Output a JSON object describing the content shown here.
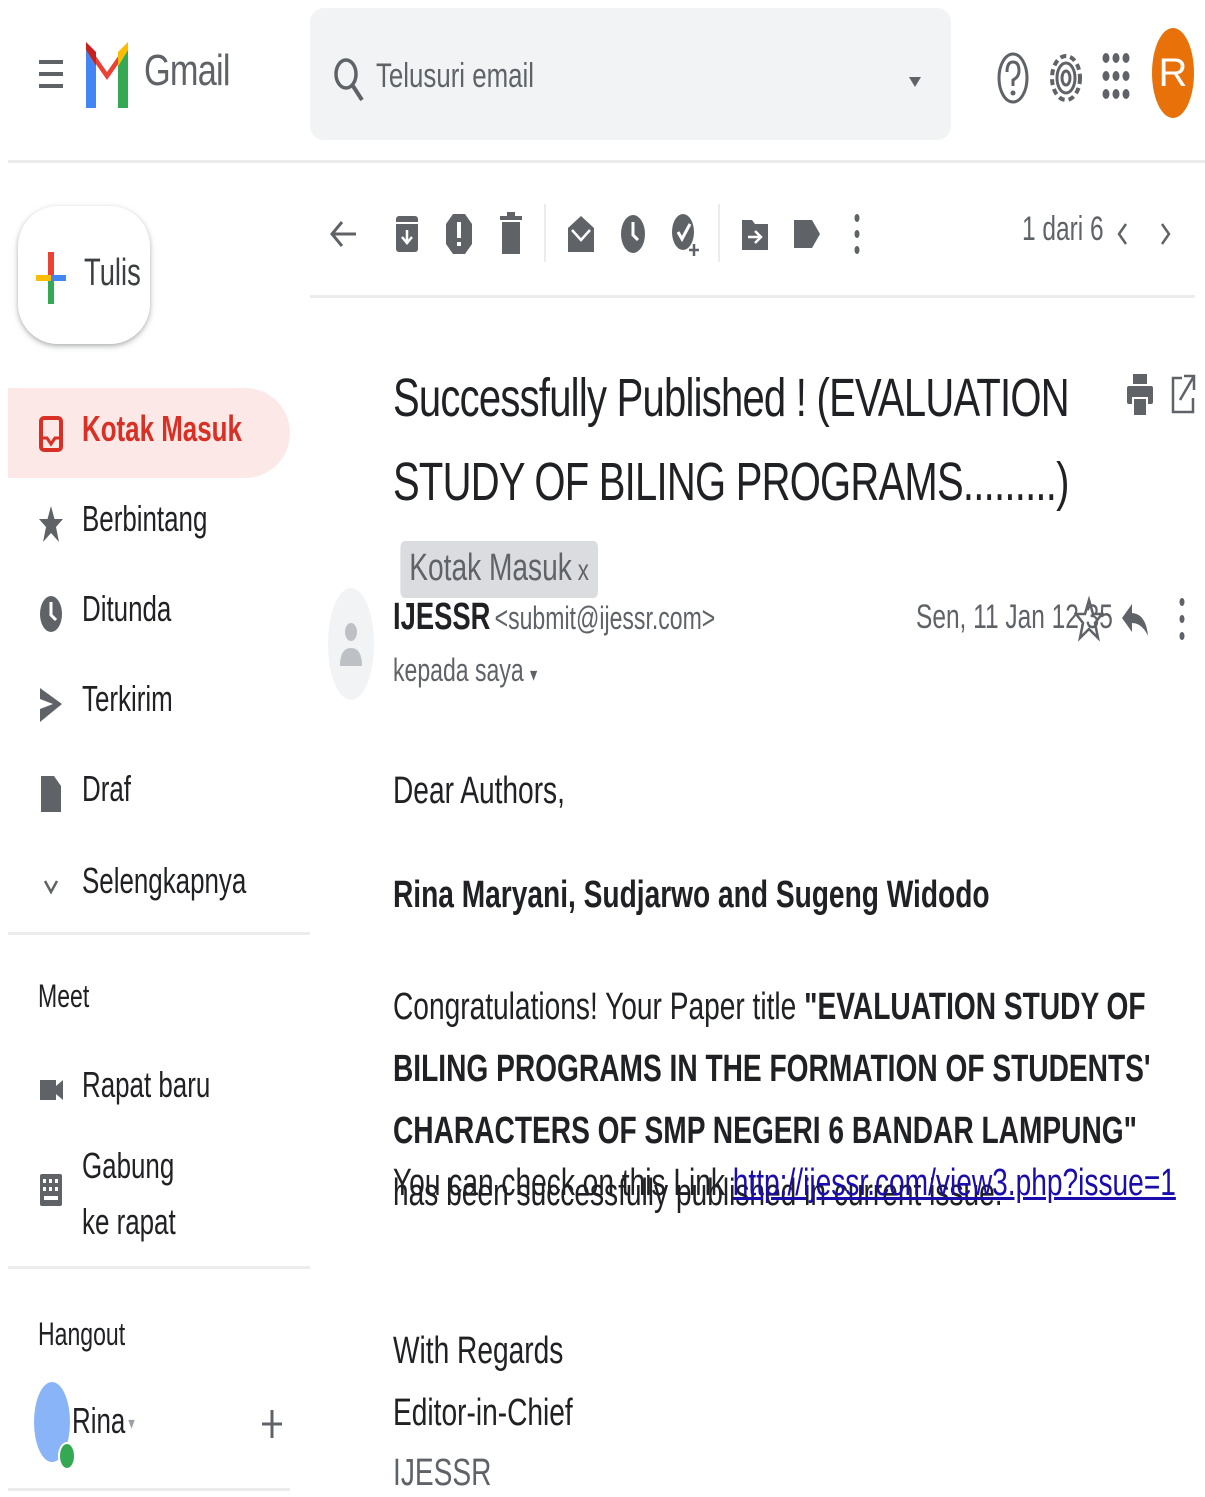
{
  "app": {
    "name": "Gmail",
    "menu_icon": "hamburger-menu-icon",
    "logo": "gmail-logo"
  },
  "search": {
    "placeholder": "Telusuri email"
  },
  "header_icons": [
    "help-icon",
    "settings-icon",
    "apps-grid-icon"
  ],
  "account": {
    "initial": "R",
    "color": "#e8710a"
  },
  "compose": {
    "label": "Tulis"
  },
  "nav": [
    {
      "label": "Kotak Masuk",
      "icon": "inbox-icon",
      "active": true
    },
    {
      "label": "Berbintang",
      "icon": "star-icon"
    },
    {
      "label": "Ditunda",
      "icon": "clock-icon"
    },
    {
      "label": "Terkirim",
      "icon": "send-icon"
    },
    {
      "label": "Draf",
      "icon": "draft-icon"
    },
    {
      "label": "Selengkapnya",
      "icon": "chevron-down-icon"
    }
  ],
  "meet": {
    "title": "Meet",
    "items": [
      {
        "label": "Rapat baru",
        "icon": "video-icon"
      },
      {
        "label": "Gabung ke rapat",
        "icon": "keyboard-icon"
      }
    ]
  },
  "hangout": {
    "title": "Hangout",
    "user": "Rina"
  },
  "toolbar": {
    "icons": [
      "back-arrow-icon",
      "archive-icon",
      "report-spam-icon",
      "delete-icon",
      "mark-unread-icon",
      "snooze-icon",
      "add-task-icon",
      "move-to-icon",
      "label-icon",
      "more-vert-icon"
    ],
    "page_count": "1 dari 6"
  },
  "message": {
    "subject": "Successfully Published ! (EVALUATION STUDY OF BILING PROGRAMS.........)",
    "label": "Kotak Masuk",
    "sender_name": "IJESSR",
    "sender_email": "<submit@ijessr.com>",
    "recipient": "kepada saya",
    "date": "Sen, 11 Jan 12.35",
    "body": {
      "greeting": "Dear Authors,",
      "authors": "Rina Maryani, Sudjarwo and Sugeng Widodo",
      "congrats_prefix": "Congratulations! Your Paper title ",
      "paper_title": "\"EVALUATION STUDY OF BILING PROGRAMS IN THE FORMATION OF STUDENTS' CHARACTERS OF SMP NEGERI 6 BANDAR LAMPUNG\"",
      "congrats_suffix": " has been successfully published in current issue.",
      "check_text": "You can check on this Link ",
      "link": "http://ijessr.com/view3.php?issue=1",
      "regards": "With Regards",
      "signoff": "Editor-in-Chief",
      "journal": "IJESSR"
    }
  },
  "colors": {
    "accent_red": "#d93025",
    "active_bg": "#fce8e6",
    "link": "#1a0dab"
  }
}
